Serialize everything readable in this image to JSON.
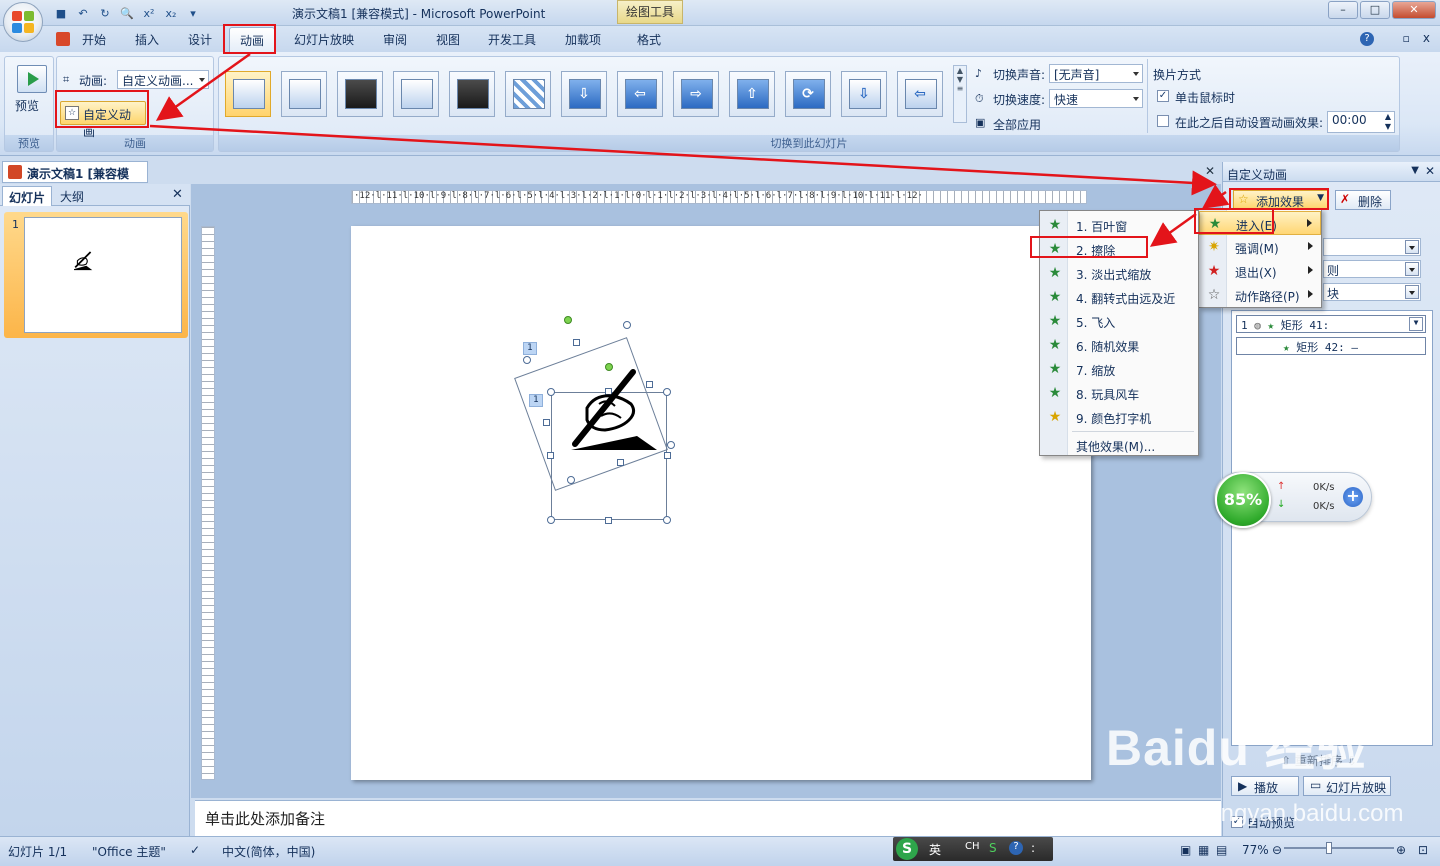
{
  "title_bar": {
    "title": "演示文稿1 [兼容模式] - Microsoft PowerPoint",
    "context_tab": "绘图工具",
    "window_buttons": [
      "–",
      "□",
      "✕"
    ]
  },
  "ribbon_tabs": [
    "开始",
    "插入",
    "设计",
    "动画",
    "幻灯片放映",
    "审阅",
    "视图",
    "开发工具",
    "加载项",
    "格式"
  ],
  "ribbon": {
    "preview_group": {
      "button": "预览",
      "label": "预览"
    },
    "animation_group": {
      "anim_label": "动画:",
      "anim_value": "自定义动画...",
      "custom_anim_button": "自定义动画",
      "label": "动画"
    },
    "transition_group": {
      "label": "切换到此幻灯片",
      "sound_label": "切换声音:",
      "sound_value": "[无声音]",
      "speed_label": "切换速度:",
      "speed_value": "快速",
      "apply_all": "全部应用"
    },
    "advance_group": {
      "title": "换片方式",
      "on_click": "单击鼠标时",
      "auto_after": "在此之后自动设置动画效果:",
      "time_value": "00:00"
    }
  },
  "doc_tab": "演示文稿1 [兼容模式]",
  "left_pane": {
    "tabs": [
      "幻灯片",
      "大纲"
    ],
    "slide_number": "1"
  },
  "notes_placeholder": "单击此处添加备注",
  "task_pane": {
    "title": "自定义动画",
    "add_effect": "添加效果",
    "remove": "删除",
    "combo_partial": [
      "",
      "则",
      "块"
    ],
    "list_items": [
      {
        "num": "1",
        "text": "矩形 41:"
      },
      {
        "num": "",
        "text": "矩形 42: —"
      }
    ],
    "reorder": "重新排序",
    "play": "播放",
    "slideshow": "幻灯片放映",
    "autopreview": "自动预览"
  },
  "effect_menu": {
    "items": [
      "进入(E)",
      "强调(M)",
      "退出(X)",
      "动作路径(P)"
    ]
  },
  "entrance_menu": {
    "items": [
      "1. 百叶窗",
      "2. 擦除",
      "3. 淡出式缩放",
      "4. 翻转式由远及近",
      "5. 飞入",
      "6. 随机效果",
      "7. 缩放",
      "8. 玩具风车",
      "9. 颜色打字机"
    ],
    "more": "其他效果(M)..."
  },
  "net_widget": {
    "percent": "85%",
    "up": "0K/s",
    "down": "0K/s"
  },
  "status_bar": {
    "slide_info": "幻灯片 1/1",
    "theme": "\"Office 主题\"",
    "language": "中文(简体，中国)",
    "zoom": "77%"
  },
  "ime": {
    "logo": "S",
    "mode": "英",
    "ch": "CH"
  },
  "ruler": {
    "h": "·12·l·11·l·10·l·9·l·8·l·7·l·6·l·5·l·4·l·3·l·2·l·1·l·0·l·1·l·2·l·3·l·4·l·5·l·6·l·7·l·8·l·9·l·10·l·11·l·12·"
  },
  "anim_tags": [
    "1",
    "1"
  ],
  "watermark": {
    "text": "Baidu 经验",
    "url": "jingyan.baidu.com"
  },
  "colors": {
    "accent_red": "#e3141a",
    "ribbon_blue": "#dbe7f6",
    "highlight": "#ffd674"
  }
}
